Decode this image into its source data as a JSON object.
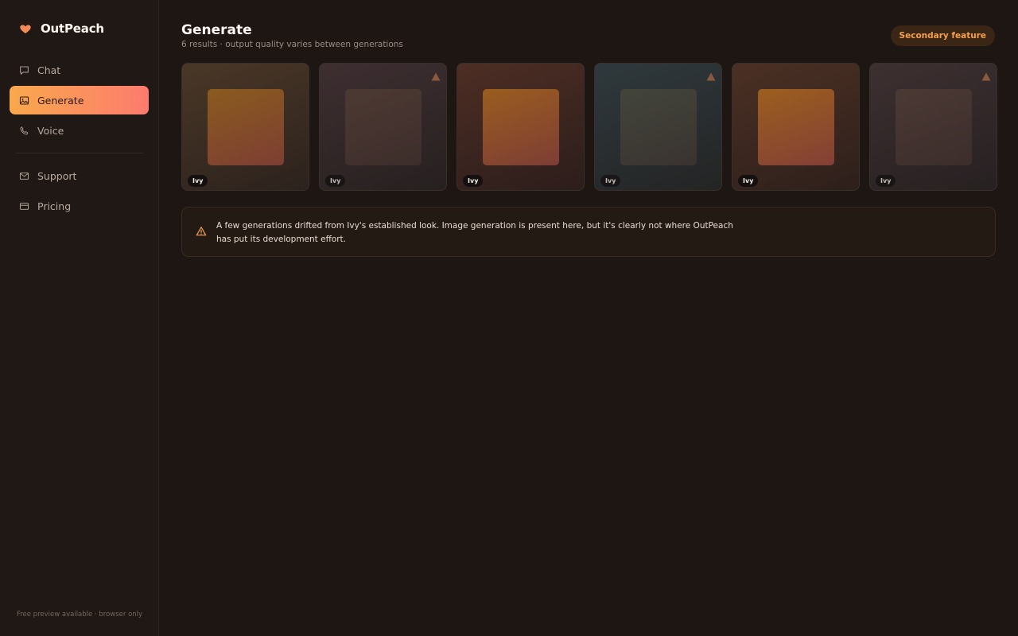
{
  "app": {
    "name": "OutPeach",
    "footer": "Free preview available · browser only"
  },
  "nav": {
    "items": [
      {
        "label": "Chat",
        "icon": "chat-bubble-icon",
        "active": false
      },
      {
        "label": "Generate",
        "icon": "image-icon",
        "active": true
      },
      {
        "label": "Voice",
        "icon": "phone-icon",
        "active": false
      }
    ],
    "secondary": [
      {
        "label": "Support",
        "icon": "mail-icon"
      },
      {
        "label": "Pricing",
        "icon": "credit-card-icon"
      }
    ]
  },
  "page": {
    "title": "Generate",
    "subtitle": "6 results · output quality varies between generations",
    "badge": "Secondary feature"
  },
  "results": [
    {
      "tag": "Ivy",
      "drifted": false
    },
    {
      "tag": "Ivy",
      "drifted": true
    },
    {
      "tag": "Ivy",
      "drifted": false
    },
    {
      "tag": "Ivy",
      "drifted": true
    },
    {
      "tag": "Ivy",
      "drifted": false
    },
    {
      "tag": "Ivy",
      "drifted": true
    }
  ],
  "notice": {
    "icon": "warning-triangle-icon",
    "text": "A few generations drifted from Ivy's established look. Image generation is present here, but it's clearly not where OutPeach has put its development effort."
  },
  "colors": {
    "accent_start": "#f9a84c",
    "accent_end": "#fd7b6e",
    "badge_text": "#f3a04d",
    "background": "#1d1613"
  }
}
